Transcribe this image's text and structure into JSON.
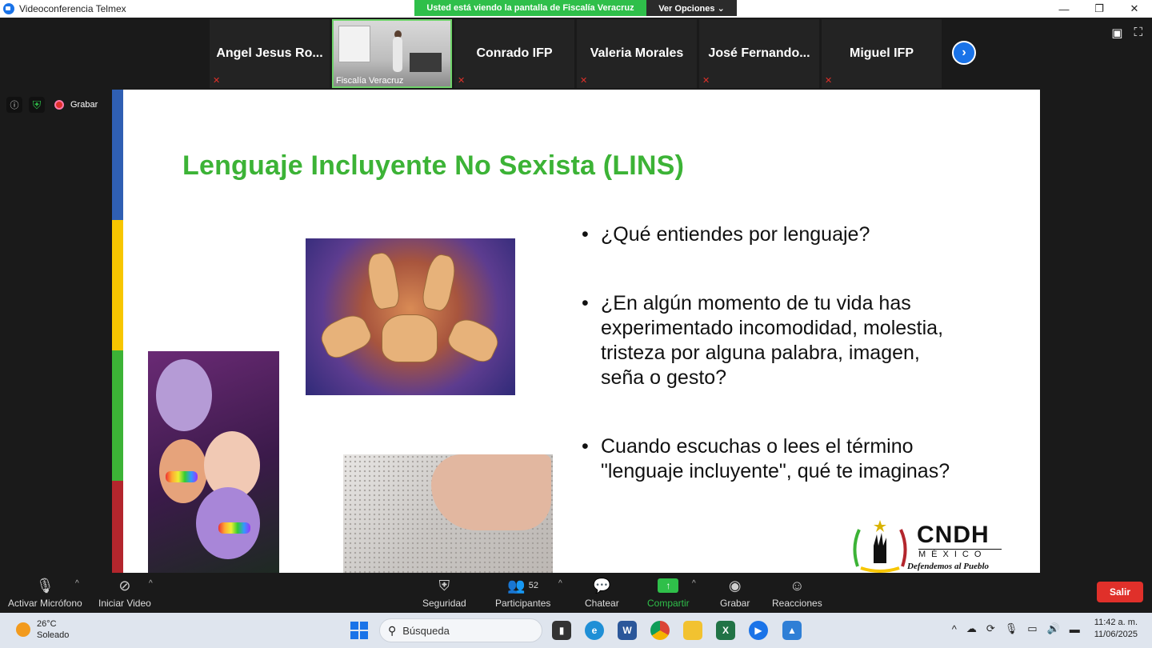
{
  "window": {
    "title": "Videoconferencia Telmex",
    "share_banner": "Usted está viendo la pantalla de Fiscalía Veracruz",
    "view_options": "Ver Opciones ⌄"
  },
  "participants": [
    {
      "name": "Angel Jesus Ro...",
      "muted": true
    },
    {
      "name": "Fiscalía Veracruz",
      "video": true,
      "muted": true
    },
    {
      "name": "Conrado IFP",
      "muted": true
    },
    {
      "name": "Valeria Morales",
      "muted": true
    },
    {
      "name": "José  Fernando...",
      "muted": true
    },
    {
      "name": "Miguel IFP",
      "muted": true
    }
  ],
  "meeting_tools": {
    "record_label": "Grabar"
  },
  "slide": {
    "title": "Lenguaje Incluyente No Sexista (LINS)",
    "bullets": [
      "¿Qué entiendes por lenguaje?",
      "¿En algún momento de tu vida has experimentado incomodidad, molestia, tristeza por alguna palabra, imagen, seña o gesto?",
      "Cuando escuchas o lees el término \"lenguaje incluyente\", qué te imaginas?"
    ],
    "logo": {
      "name": "CNDH",
      "country": "MÉXICO",
      "motto": "Defendemos al Pueblo"
    },
    "accent_color": "#3cb336",
    "bar_colors": [
      "#2f5fb3",
      "#f7c600",
      "#3cb336",
      "#b3262d"
    ]
  },
  "toolbar": {
    "mic": "Activar Micrófono",
    "video": "Iniciar Video",
    "security": "Seguridad",
    "participants": "Participantes",
    "participants_count": "52",
    "chat": "Chatear",
    "share": "Compartir",
    "record": "Grabar",
    "reactions": "Reacciones",
    "leave": "Salir"
  },
  "taskbar": {
    "weather_temp": "26°C",
    "weather_desc": "Soleado",
    "search_placeholder": "Búsqueda",
    "time": "11:42 a. m.",
    "date": "11/06/2025"
  }
}
